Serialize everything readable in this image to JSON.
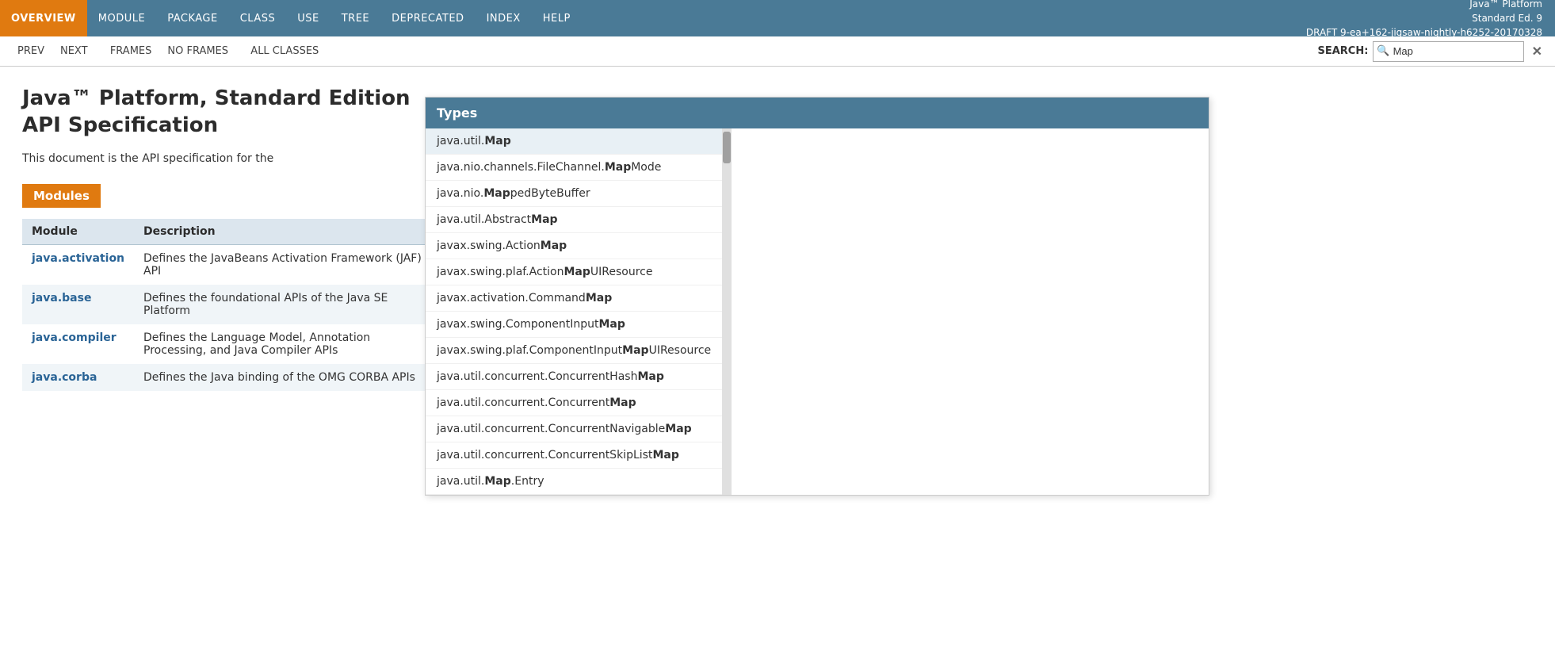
{
  "version_info": {
    "line1": "Java™ Platform",
    "line2": "Standard Ed. 9",
    "line3": "DRAFT 9-ea+162-jigsaw-nightly-h6252-20170328"
  },
  "top_nav": {
    "items": [
      {
        "id": "overview",
        "label": "OVERVIEW",
        "active": true
      },
      {
        "id": "module",
        "label": "MODULE",
        "active": false
      },
      {
        "id": "package",
        "label": "PACKAGE",
        "active": false
      },
      {
        "id": "class",
        "label": "CLASS",
        "active": false
      },
      {
        "id": "use",
        "label": "USE",
        "active": false
      },
      {
        "id": "tree",
        "label": "TREE",
        "active": false
      },
      {
        "id": "deprecated",
        "label": "DEPRECATED",
        "active": false
      },
      {
        "id": "index",
        "label": "INDEX",
        "active": false
      },
      {
        "id": "help",
        "label": "HELP",
        "active": false
      }
    ]
  },
  "second_nav": {
    "prev": "PREV",
    "next": "NEXT",
    "frames": "FRAMES",
    "no_frames": "NO FRAMES",
    "all_classes": "ALL CLASSES",
    "search_label": "SEARCH:",
    "search_value": "Map",
    "search_placeholder": "",
    "clear_button": "✕"
  },
  "page": {
    "title": "Java™ Platform, Standard Edition\nAPI Specification",
    "description": "This document is the API specification for the",
    "modules_heading": "Modules",
    "table_headers": [
      "Module",
      "Description"
    ],
    "modules": [
      {
        "name": "java.activation",
        "description": "Defines the JavaBeans Activation Framework (JAF) API"
      },
      {
        "name": "java.base",
        "description": "Defines the foundational APIs of the Java SE Platform"
      },
      {
        "name": "java.compiler",
        "description": "Defines the Language Model, Annotation Processing, and Java Compiler APIs"
      },
      {
        "name": "java.corba",
        "description": "Defines the Java binding of the OMG CORBA APIs"
      }
    ]
  },
  "autocomplete": {
    "header": "Types",
    "items": [
      {
        "prefix": "java.util.",
        "match": "Map",
        "suffix": ""
      },
      {
        "prefix": "java.nio.channels.FileChannel.",
        "match": "Map",
        "suffix": "Mode"
      },
      {
        "prefix": "java.nio.",
        "match": "Map",
        "suffix": "pedByteBuffer"
      },
      {
        "prefix": "java.util.Abstract",
        "match": "Map",
        "suffix": ""
      },
      {
        "prefix": "javax.swing.Action",
        "match": "Map",
        "suffix": ""
      },
      {
        "prefix": "javax.swing.plaf.Action",
        "match": "Map",
        "suffix": "UIResource"
      },
      {
        "prefix": "javax.activation.Command",
        "match": "Map",
        "suffix": ""
      },
      {
        "prefix": "javax.swing.ComponentInput",
        "match": "Map",
        "suffix": ""
      },
      {
        "prefix": "javax.swing.plaf.ComponentInput",
        "match": "Map",
        "suffix": "UIResource"
      },
      {
        "prefix": "java.util.concurrent.ConcurrentHash",
        "match": "Map",
        "suffix": ""
      },
      {
        "prefix": "java.util.concurrent.Concurrent",
        "match": "Map",
        "suffix": ""
      },
      {
        "prefix": "java.util.concurrent.ConcurrentNavigable",
        "match": "Map",
        "suffix": ""
      },
      {
        "prefix": "java.util.concurrent.ConcurrentSkipList",
        "match": "Map",
        "suffix": ""
      },
      {
        "prefix": "java.util.",
        "match": "Map",
        "suffix": ".Entry"
      }
    ]
  }
}
